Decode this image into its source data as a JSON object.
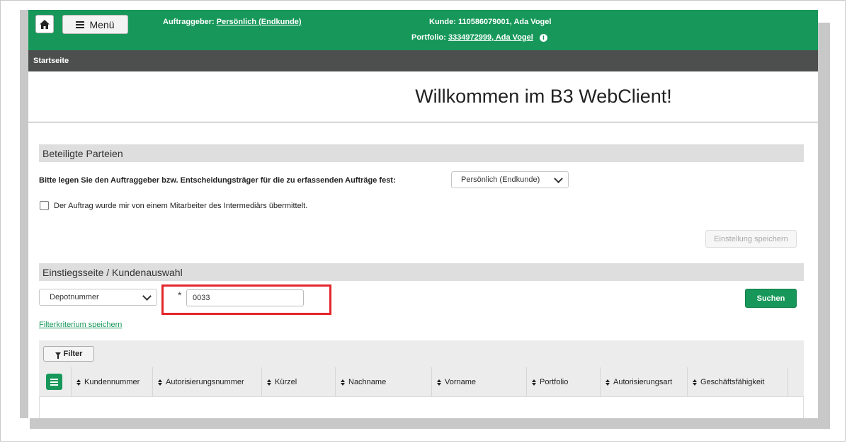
{
  "header": {
    "menu_label": "Menü",
    "auftraggeber_label": "Auftraggeber:",
    "auftraggeber_value": "Persönlich (Endkunde)",
    "kunde_label": "Kunde:",
    "kunde_value": "110586079001, Ada Vogel",
    "portfolio_label": "Portfolio:",
    "portfolio_value": "3334972999, Ada Vogel",
    "brand_color": "#17985a"
  },
  "nav": {
    "breadcrumb": "Startseite"
  },
  "welcome": {
    "title": "Willkommen im B3 WebClient!"
  },
  "parties": {
    "section_title": "Beteiligte Parteien",
    "prompt": "Bitte legen Sie den Auftraggeber bzw. Entscheidungsträger für die zu erfassenden Aufträge fest:",
    "selected": "Persönlich (Endkunde)",
    "checkbox_label": "Der Auftrag wurde mir von einem Mitarbeiter des Intermediärs übermittelt.",
    "checkbox_checked": false,
    "save_button": "Einstellung speichern"
  },
  "search": {
    "section_title": "Einstiegsseite / Kundenauswahl",
    "criterion": "Depotnummer",
    "required_marker": "*",
    "value": "0033",
    "search_button": "Suchen",
    "save_filter_link": "Filterkriterium speichern",
    "filter_button": "Filter"
  },
  "table": {
    "columns": [
      "Kundennummer",
      "Autorisierungsnummer",
      "Kürzel",
      "Nachname",
      "Vorname",
      "Portfolio",
      "Autorisierungsart",
      "Geschäftsfähigkeit"
    ]
  }
}
